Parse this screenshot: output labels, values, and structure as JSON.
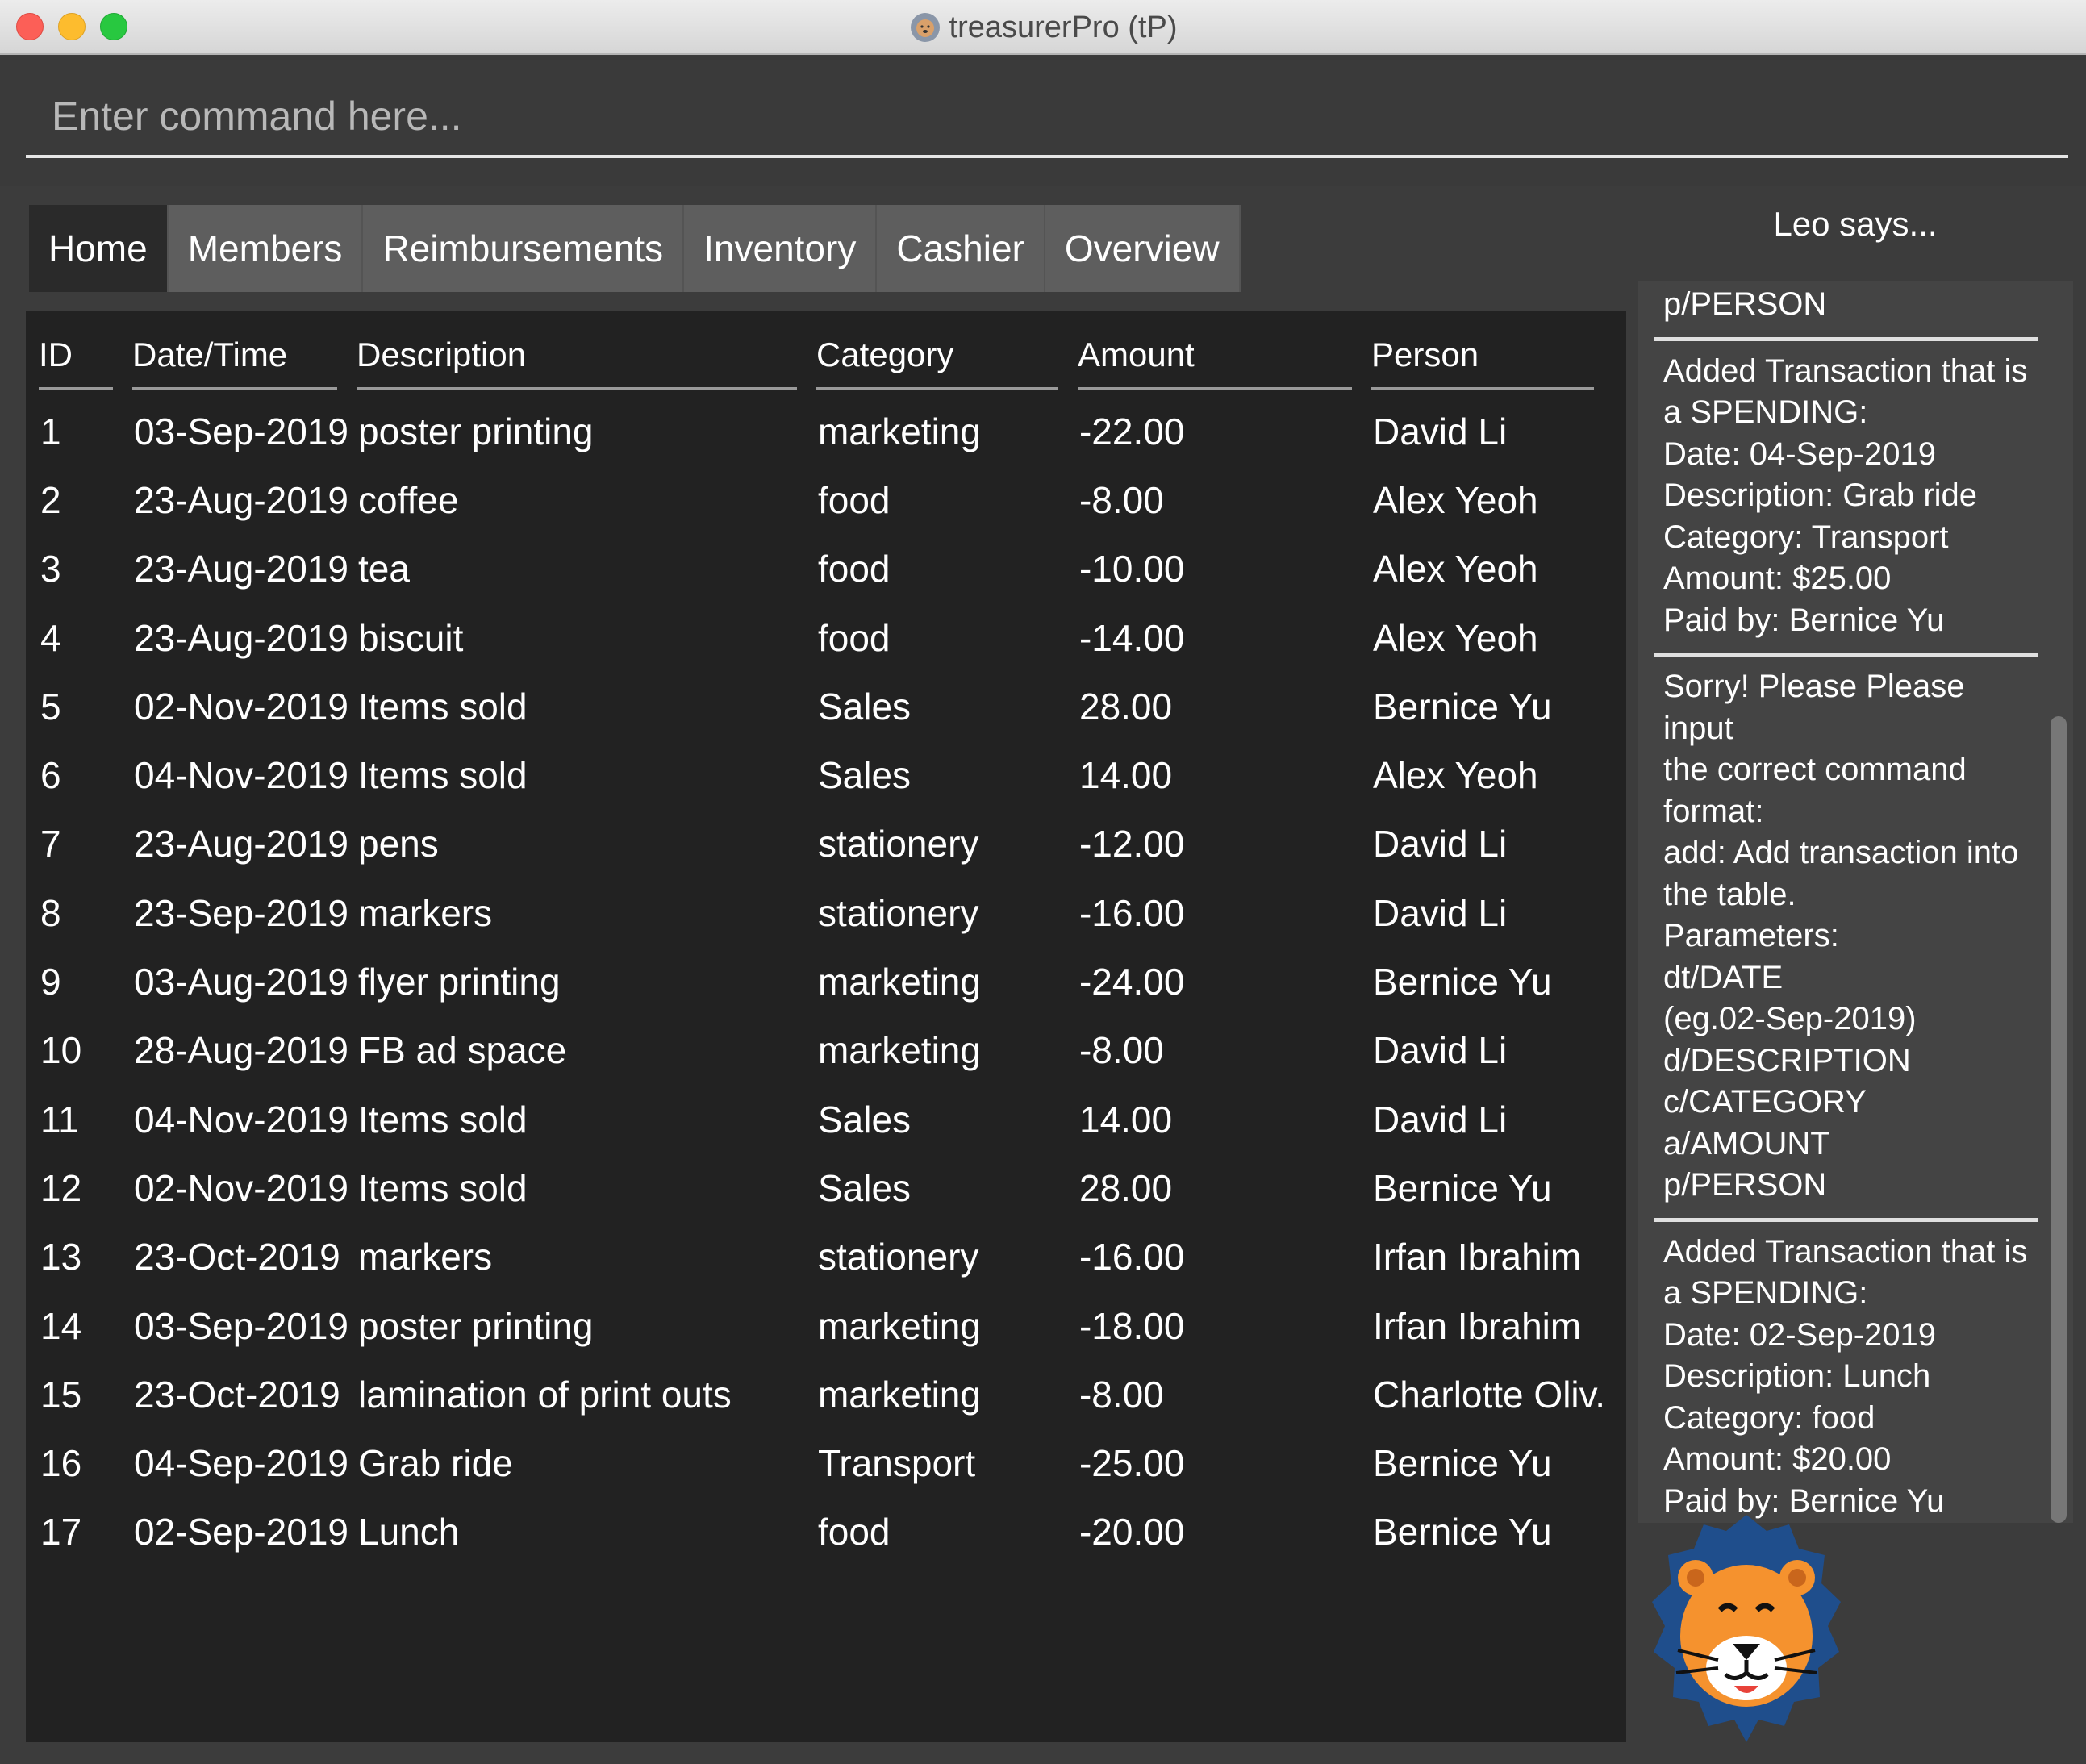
{
  "window": {
    "title": "treasurerPro (tP)"
  },
  "command": {
    "placeholder": "Enter command here..."
  },
  "tabs": [
    "Home",
    "Members",
    "Reimbursements",
    "Inventory",
    "Cashier",
    "Overview"
  ],
  "active_tab": "Home",
  "table": {
    "headers": {
      "id": "ID",
      "date": "Date/Time",
      "description": "Description",
      "category": "Category",
      "amount": "Amount",
      "person": "Person"
    },
    "rows": [
      {
        "id": "1",
        "date": "03-Sep-2019",
        "description": "poster printing",
        "category": "marketing",
        "amount": "-22.00",
        "person": "David Li"
      },
      {
        "id": "2",
        "date": "23-Aug-2019",
        "description": "coffee",
        "category": "food",
        "amount": "-8.00",
        "person": "Alex Yeoh"
      },
      {
        "id": "3",
        "date": "23-Aug-2019",
        "description": "tea",
        "category": "food",
        "amount": "-10.00",
        "person": "Alex Yeoh"
      },
      {
        "id": "4",
        "date": "23-Aug-2019",
        "description": "biscuit",
        "category": "food",
        "amount": "-14.00",
        "person": "Alex Yeoh"
      },
      {
        "id": "5",
        "date": "02-Nov-2019",
        "description": "Items sold",
        "category": "Sales",
        "amount": "28.00",
        "person": "Bernice Yu"
      },
      {
        "id": "6",
        "date": "04-Nov-2019",
        "description": "Items sold",
        "category": "Sales",
        "amount": "14.00",
        "person": "Alex Yeoh"
      },
      {
        "id": "7",
        "date": "23-Aug-2019",
        "description": "pens",
        "category": "stationery",
        "amount": "-12.00",
        "person": "David Li"
      },
      {
        "id": "8",
        "date": "23-Sep-2019",
        "description": "markers",
        "category": "stationery",
        "amount": "-16.00",
        "person": "David Li"
      },
      {
        "id": "9",
        "date": "03-Aug-2019",
        "description": "flyer printing",
        "category": "marketing",
        "amount": "-24.00",
        "person": "Bernice Yu"
      },
      {
        "id": "10",
        "date": "28-Aug-2019",
        "description": "FB ad space",
        "category": "marketing",
        "amount": "-8.00",
        "person": "David Li"
      },
      {
        "id": "11",
        "date": "04-Nov-2019",
        "description": "Items sold",
        "category": "Sales",
        "amount": "14.00",
        "person": "David Li"
      },
      {
        "id": "12",
        "date": "02-Nov-2019",
        "description": "Items sold",
        "category": "Sales",
        "amount": "28.00",
        "person": "Bernice Yu"
      },
      {
        "id": "13",
        "date": "23-Oct-2019",
        "description": "markers",
        "category": "stationery",
        "amount": "-16.00",
        "person": "Irfan Ibrahim"
      },
      {
        "id": "14",
        "date": "03-Sep-2019",
        "description": "poster printing",
        "category": "marketing",
        "amount": "-18.00",
        "person": "Irfan Ibrahim"
      },
      {
        "id": "15",
        "date": "23-Oct-2019",
        "description": "lamination of print outs",
        "category": "marketing",
        "amount": "-8.00",
        "person": "Charlotte Oliv..."
      },
      {
        "id": "16",
        "date": "04-Sep-2019",
        "description": "Grab ride",
        "category": "Transport",
        "amount": "-25.00",
        "person": "Bernice Yu"
      },
      {
        "id": "17",
        "date": "02-Sep-2019",
        "description": "Lunch",
        "category": "food",
        "amount": "-20.00",
        "person": "Bernice Yu"
      }
    ]
  },
  "assistant": {
    "heading": "Leo says...",
    "messages": [
      [
        "p/PERSON"
      ],
      [
        "Added Transaction that is",
        "a SPENDING:",
        "Date: 04-Sep-2019",
        "Description: Grab ride",
        "Category: Transport",
        "Amount: $25.00",
        "Paid by: Bernice Yu"
      ],
      [
        "Sorry! Please Please input",
        "the correct command",
        "format:",
        "add: Add transaction into",
        "the table.",
        "Parameters:",
        "dt/DATE",
        "(eg.02-Sep-2019)",
        "d/DESCRIPTION",
        "c/CATEGORY a/AMOUNT",
        "p/PERSON"
      ],
      [
        "Added Transaction that is",
        "a SPENDING:",
        "Date: 02-Sep-2019",
        "Description: Lunch",
        "Category: food",
        "Amount: $20.00",
        "Paid by: Bernice Yu"
      ]
    ]
  },
  "colors": {
    "background": "#3c3c3c",
    "table_bg": "#222222",
    "tab_active": "#2a2a2a",
    "tab_inactive": "#5e5e5e",
    "text": "#ffffff",
    "lion_mane": "#1f4e8c",
    "lion_face": "#f5922e"
  }
}
